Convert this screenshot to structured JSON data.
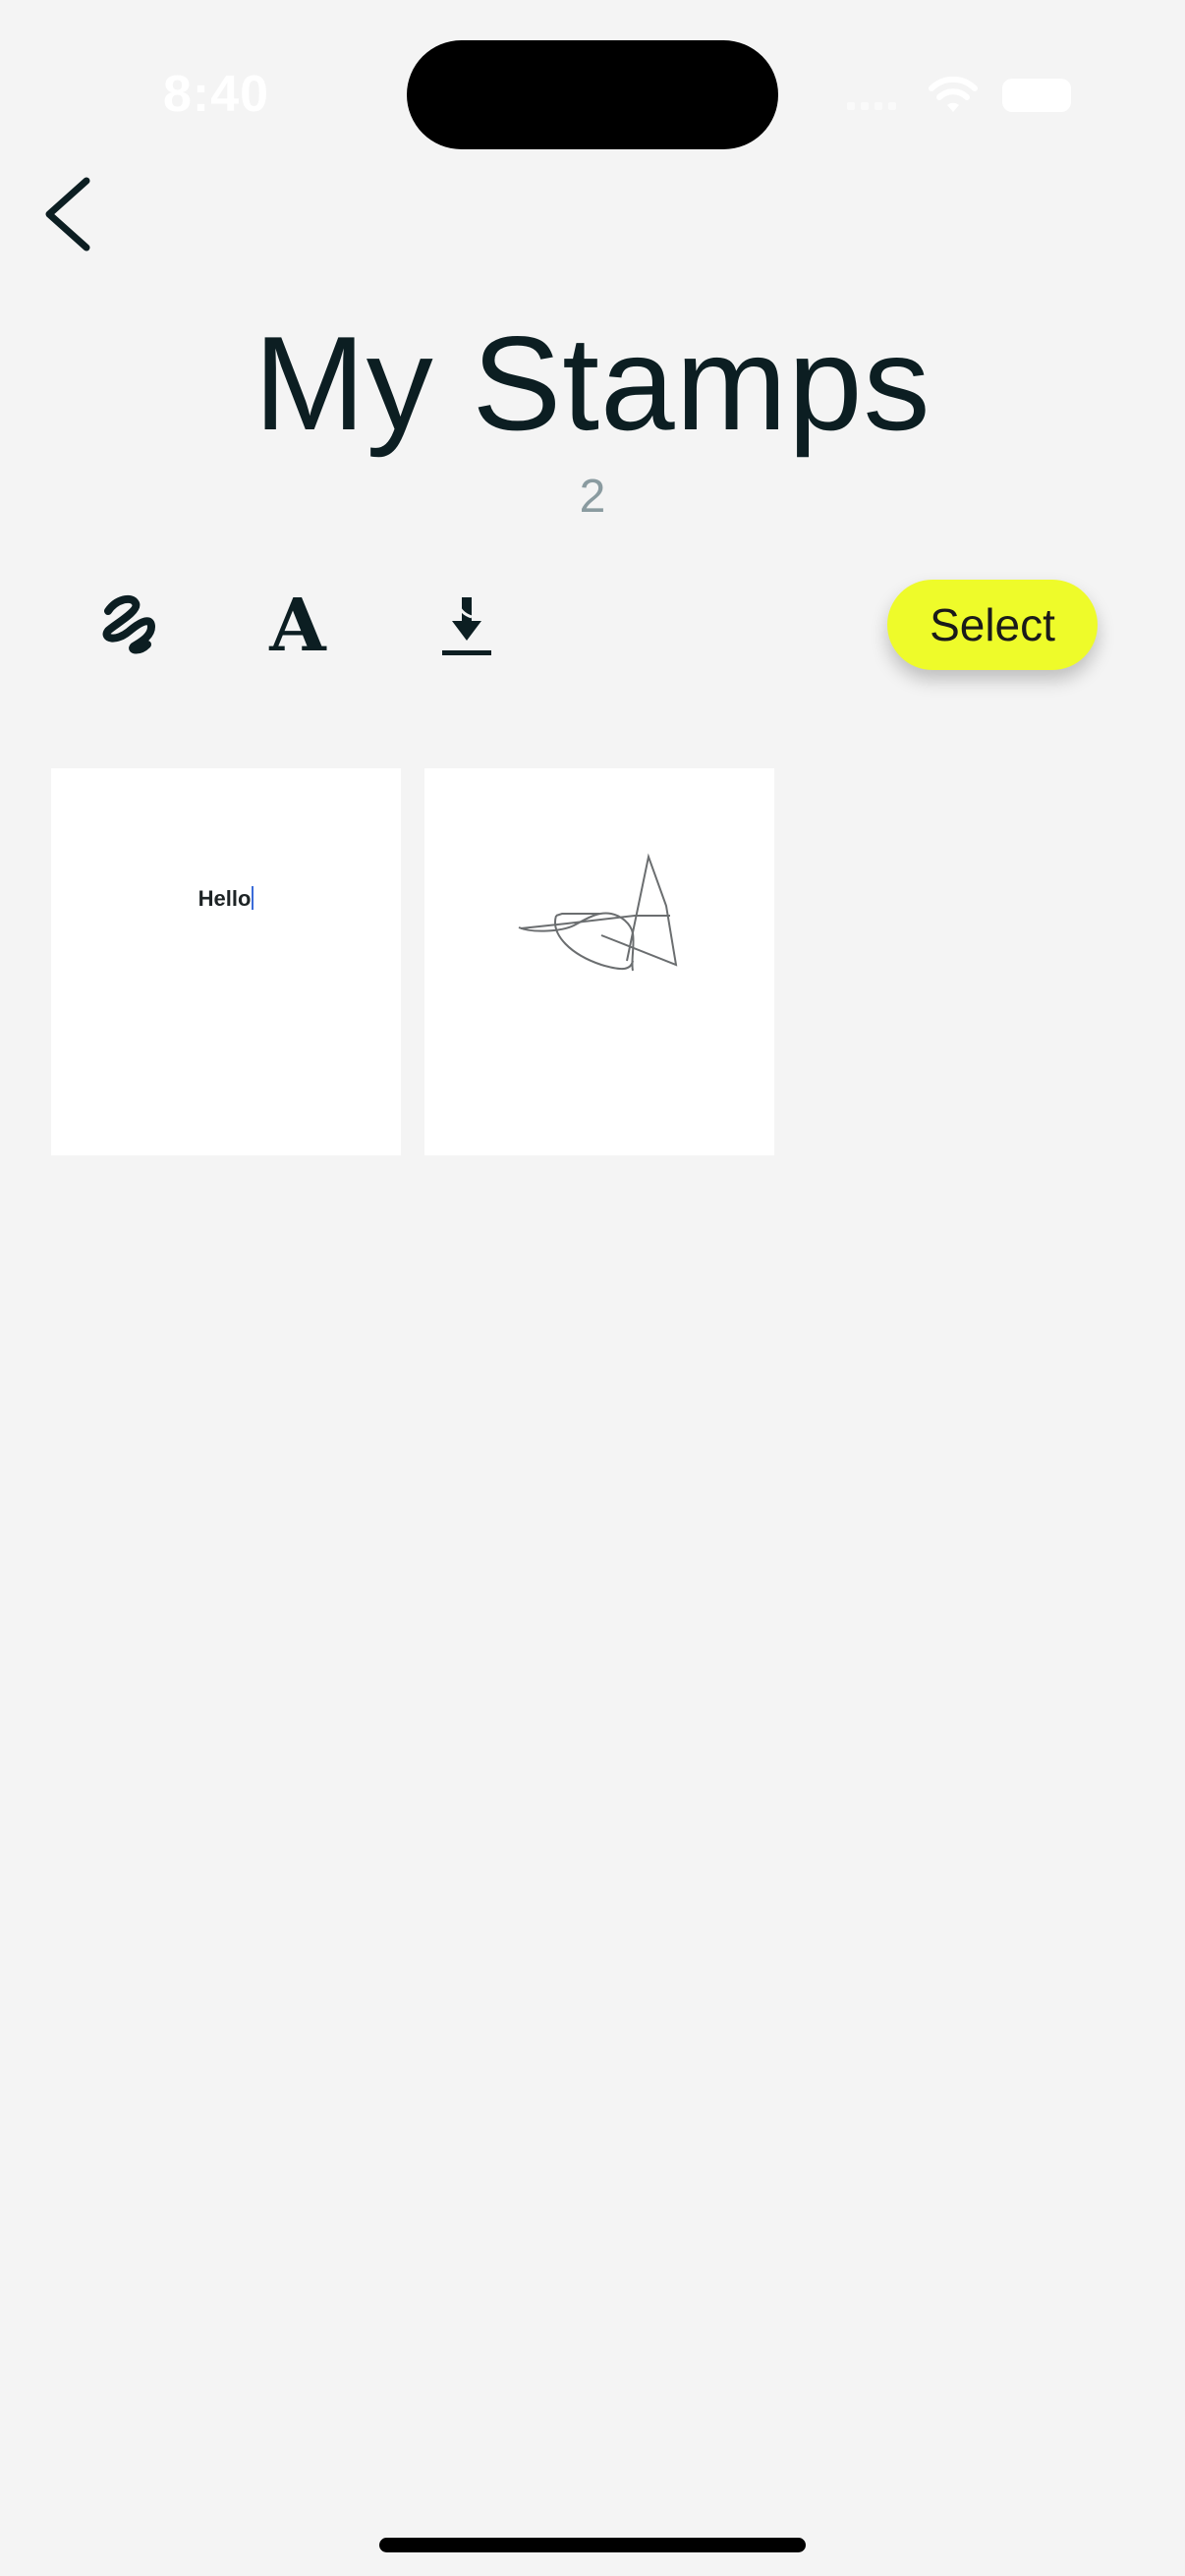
{
  "status_bar": {
    "time": "8:40"
  },
  "header": {
    "back_icon": "chevron-left-icon",
    "title": "My Stamps",
    "count": "2"
  },
  "toolbar": {
    "draw_icon": "signature-scribble-icon",
    "text_icon": "text-letter-icon",
    "text_icon_glyph": "A",
    "import_icon": "download-icon",
    "select_label": "Select",
    "select_color": "#eefb2a"
  },
  "stamps": [
    {
      "type": "text",
      "text": "Hello"
    },
    {
      "type": "signature"
    }
  ],
  "colors": {
    "background": "#f4f4f4",
    "title": "#0c1e22",
    "count": "#8a9ba0",
    "accent": "#eefb2a"
  }
}
